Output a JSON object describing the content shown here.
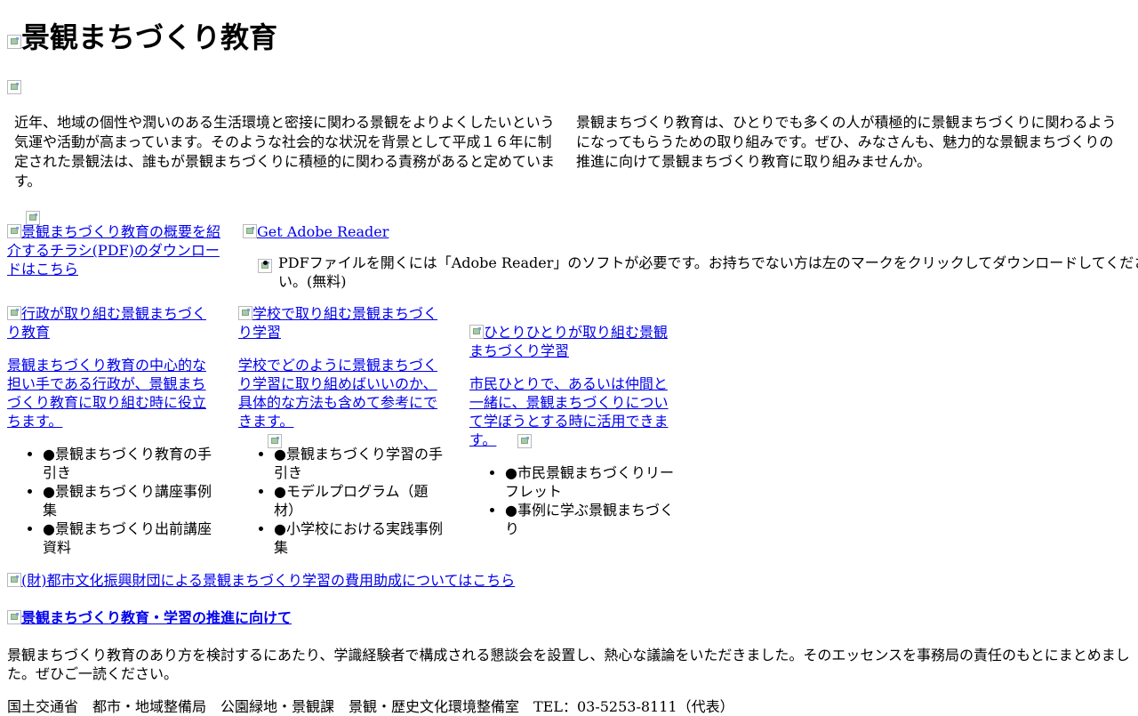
{
  "header": {
    "title": "景観まちづくり教育"
  },
  "intro": {
    "left": "近年、地域の個性や潤いのある生活環境と密接に関わる景観をよりよくしたいという気運や活動が高まっています。そのような社会的な状況を背景として平成１６年に制定された景観法は、誰もが景観まちづくりに積極的に関わる責務があると定めています。",
    "right": "景観まちづくり教育は、ひとりでも多くの人が積極的に景観まちづくりに関わるようになってもらうための取り組みです。ぜひ、みなさんも、魅力的な景観まちづくりの推進に向けて景観まちづくり教育に取り組みませんか。"
  },
  "download": {
    "flyer_link": "景観まちづくり教育の概要を紹介するチラシ(PDF)のダウンロードはこちら",
    "adobe_link": "Get Adobe Reader",
    "adobe_note": "PDFファイルを開くには「Adobe Reader」のソフトが必要です。お持ちでない方は左のマークをクリックしてダウンロードしてください。(無料)"
  },
  "columns": [
    {
      "image_link": "行政が取り組む景観まちづくり教育",
      "desc_link": "景観まちづくり教育の中心的な担い手である行政が、景観まちづくり教育に取り組む時に役立ちます。",
      "items": [
        "●景観まちづくり教育の手引き",
        "●景観まちづくり講座事例集",
        "●景観まちづくり出前講座資料"
      ]
    },
    {
      "image_link": "学校で取り組む景観まちづくり学習",
      "desc_link": "学校でどのように景観まちづくり学習に取り組めばいいのか、具体的な方法も含めて参考にできます。",
      "items": [
        "●景観まちづくり学習の手引き",
        "●モデルプログラム（題材）",
        "●小学校における実践事例集"
      ]
    },
    {
      "image_link": "ひとりひとりが取り組む景観まちづくり学習",
      "desc_link": "市民ひとりで、あるいは仲間と一緒に、景観まちづくりについて学ぼうとする時に活用できます。",
      "items": [
        "●市民景観まちづくりリーフレット",
        "●事例に学ぶ景観まちづくり"
      ]
    }
  ],
  "grant": {
    "link": "(財)都市文化振興財団による景観まちづくり学習の費用助成についてはこちら"
  },
  "promotion": {
    "heading_link": "景観まちづくり教育・学習の推進に向けて",
    "text": "景観まちづくり教育のあり方を検討するにあたり、学識経験者で構成される懇談会を設置し、熱心な議論をいただきました。そのエッセンスを事務局の責任のもとにまとめました。ぜひご一読ください。"
  },
  "footer": {
    "contact": "国土交通省　都市・地域整備局　公園緑地・景観課　景観・歴史文化環境整備室　TEL：03-5253-8111（代表）"
  }
}
